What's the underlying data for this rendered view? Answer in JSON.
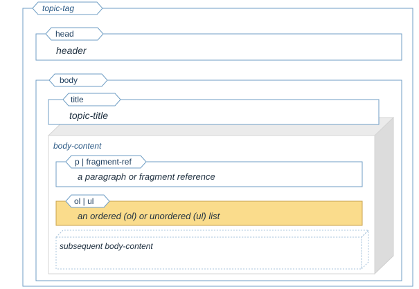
{
  "diagram": {
    "topic_tag": "topic-tag",
    "head": {
      "tab": "head",
      "content": "header"
    },
    "body": {
      "tab": "body",
      "title": {
        "tab": "title",
        "content": "topic-title"
      },
      "body_content": {
        "label": "body-content",
        "paragraph": {
          "tab": "p | fragment-ref",
          "content": "a paragraph or fragment reference"
        },
        "list": {
          "tab": "ol | ul",
          "content": "an ordered (ol) or unordered (ul) list"
        },
        "subsequent": "subsequent body-content"
      }
    }
  },
  "colors": {
    "line": "#6f9ec4",
    "highlight_fill": "#fadc8c",
    "highlight_border": "#c8a24b",
    "box3d_side": "#dcdcdc",
    "box3d_top": "#ebebeb"
  }
}
